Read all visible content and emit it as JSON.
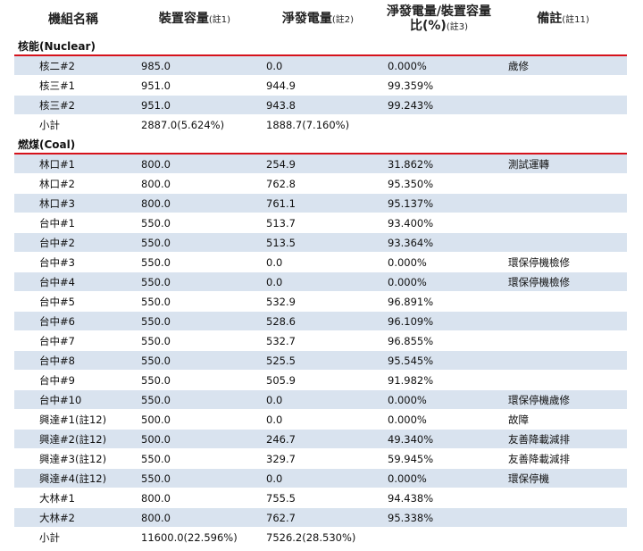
{
  "header": {
    "unit_name": "機組名稱",
    "capacity": "裝置容量",
    "capacity_note": "(註1)",
    "net_gen": "淨發電量",
    "net_gen_note": "(註2)",
    "ratio": "淨發電量/裝置容量比(%)",
    "ratio_note": "(註3)",
    "remark": "備註",
    "remark_note": "(註11)"
  },
  "sections": [
    {
      "title": "核能(Nuclear)",
      "rows": [
        {
          "name": "核二#2",
          "capacity": "985.0",
          "net": "0.0",
          "ratio": "0.000%",
          "remark": "歲修"
        },
        {
          "name": "核三#1",
          "capacity": "951.0",
          "net": "944.9",
          "ratio": "99.359%",
          "remark": ""
        },
        {
          "name": "核三#2",
          "capacity": "951.0",
          "net": "943.8",
          "ratio": "99.243%",
          "remark": ""
        }
      ],
      "subtotal": {
        "name": "小計",
        "capacity": "2887.0(5.624%)",
        "net": "1888.7(7.160%)"
      }
    },
    {
      "title": "燃煤(Coal)",
      "rows": [
        {
          "name": "林口#1",
          "capacity": "800.0",
          "net": "254.9",
          "ratio": "31.862%",
          "remark": "測試運轉"
        },
        {
          "name": "林口#2",
          "capacity": "800.0",
          "net": "762.8",
          "ratio": "95.350%",
          "remark": ""
        },
        {
          "name": "林口#3",
          "capacity": "800.0",
          "net": "761.1",
          "ratio": "95.137%",
          "remark": ""
        },
        {
          "name": "台中#1",
          "capacity": "550.0",
          "net": "513.7",
          "ratio": "93.400%",
          "remark": ""
        },
        {
          "name": "台中#2",
          "capacity": "550.0",
          "net": "513.5",
          "ratio": "93.364%",
          "remark": ""
        },
        {
          "name": "台中#3",
          "capacity": "550.0",
          "net": "0.0",
          "ratio": "0.000%",
          "remark": "環保停機檢修"
        },
        {
          "name": "台中#4",
          "capacity": "550.0",
          "net": "0.0",
          "ratio": "0.000%",
          "remark": "環保停機檢修"
        },
        {
          "name": "台中#5",
          "capacity": "550.0",
          "net": "532.9",
          "ratio": "96.891%",
          "remark": ""
        },
        {
          "name": "台中#6",
          "capacity": "550.0",
          "net": "528.6",
          "ratio": "96.109%",
          "remark": ""
        },
        {
          "name": "台中#7",
          "capacity": "550.0",
          "net": "532.7",
          "ratio": "96.855%",
          "remark": ""
        },
        {
          "name": "台中#8",
          "capacity": "550.0",
          "net": "525.5",
          "ratio": "95.545%",
          "remark": ""
        },
        {
          "name": "台中#9",
          "capacity": "550.0",
          "net": "505.9",
          "ratio": "91.982%",
          "remark": ""
        },
        {
          "name": "台中#10",
          "capacity": "550.0",
          "net": "0.0",
          "ratio": "0.000%",
          "remark": "環保停機歲修"
        },
        {
          "name": "興達#1(註12)",
          "capacity": "500.0",
          "net": "0.0",
          "ratio": "0.000%",
          "remark": "故障"
        },
        {
          "name": "興達#2(註12)",
          "capacity": "500.0",
          "net": "246.7",
          "ratio": "49.340%",
          "remark": "友善降載減排"
        },
        {
          "name": "興達#3(註12)",
          "capacity": "550.0",
          "net": "329.7",
          "ratio": "59.945%",
          "remark": "友善降載減排"
        },
        {
          "name": "興達#4(註12)",
          "capacity": "550.0",
          "net": "0.0",
          "ratio": "0.000%",
          "remark": "環保停機"
        },
        {
          "name": "大林#1",
          "capacity": "800.0",
          "net": "755.5",
          "ratio": "94.438%",
          "remark": ""
        },
        {
          "name": "大林#2",
          "capacity": "800.0",
          "net": "762.7",
          "ratio": "95.338%",
          "remark": ""
        }
      ],
      "subtotal": {
        "name": "小計",
        "capacity": "11600.0(22.596%)",
        "net": "7526.2(28.530%)"
      }
    }
  ]
}
